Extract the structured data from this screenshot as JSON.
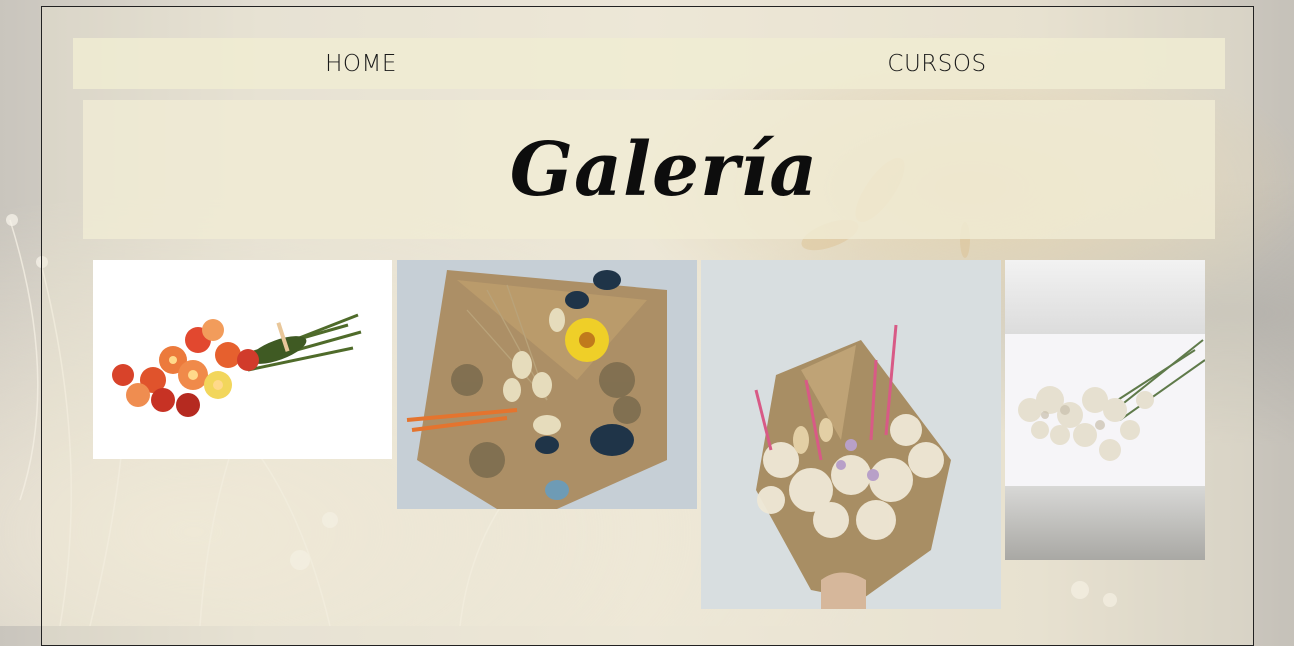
{
  "nav": {
    "items": [
      {
        "label": "HOME"
      },
      {
        "label": "CURSOS"
      }
    ]
  },
  "page": {
    "title": "Galería"
  },
  "gallery": {
    "images": [
      {
        "name": "strawflower-bouquet"
      },
      {
        "name": "dried-flower-bouquet-yellow"
      },
      {
        "name": "dried-flower-bouquet-pink"
      },
      {
        "name": "white-limonium-bunch"
      }
    ]
  },
  "colors": {
    "nav_bg": "#f0ecd2",
    "text": "#1a1a1a"
  }
}
